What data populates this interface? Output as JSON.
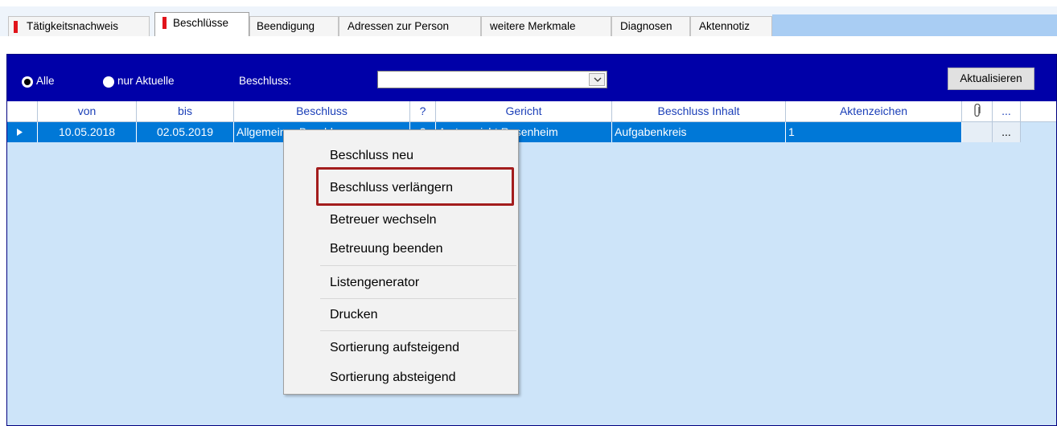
{
  "tabs": [
    {
      "label": "Tätigkeitsnachweis",
      "marked": true,
      "active": false
    },
    {
      "label": "Beschlüsse",
      "marked": true,
      "active": true
    },
    {
      "label": "Beendigung"
    },
    {
      "label": "Adressen zur Person"
    },
    {
      "label": "weitere Merkmale"
    },
    {
      "label": "Diagnosen"
    },
    {
      "label": "Aktennotiz"
    }
  ],
  "filter": {
    "radio_all": "Alle",
    "radio_all_checked": true,
    "radio_current": "nur Aktuelle",
    "beschluss_label": "Beschluss:",
    "beschluss_value": "",
    "refresh_button": "Aktualisieren"
  },
  "grid": {
    "headers": {
      "von": "von",
      "bis": "bis",
      "beschluss": "Beschluss",
      "q": "?",
      "gericht": "Gericht",
      "inhalt": "Beschluss Inhalt",
      "aktenzeichen": "Aktenzeichen",
      "attachment_icon": "paperclip-icon",
      "more": "..."
    },
    "rows": [
      {
        "von": "10.05.2018",
        "bis": "02.05.2019",
        "beschluss": "Allgemeiner Beschluss",
        "q": "?",
        "gericht": "Amtsgericht Rosenheim",
        "inhalt": "Aufgabenkreis",
        "aktenzeichen": "1",
        "more": "..."
      }
    ]
  },
  "context_menu": {
    "items": [
      {
        "label": "Beschluss neu"
      },
      {
        "label": "Beschluss verlängern",
        "highlighted": true
      },
      {
        "label": "Betreuer wechseln"
      },
      {
        "label": "Betreuung beenden"
      },
      {
        "label": "Listengenerator"
      },
      {
        "label": "Drucken"
      },
      {
        "label": "Sortierung aufsteigend"
      },
      {
        "label": "Sortierung absteigend"
      }
    ]
  },
  "colors": {
    "toolbar": "#0000a8",
    "selection": "#0078d7",
    "panel_bg": "#cde4f9",
    "tab_marker": "#e1141b",
    "highlight_box": "#a31d1d",
    "header_text": "#1b3fb8"
  }
}
